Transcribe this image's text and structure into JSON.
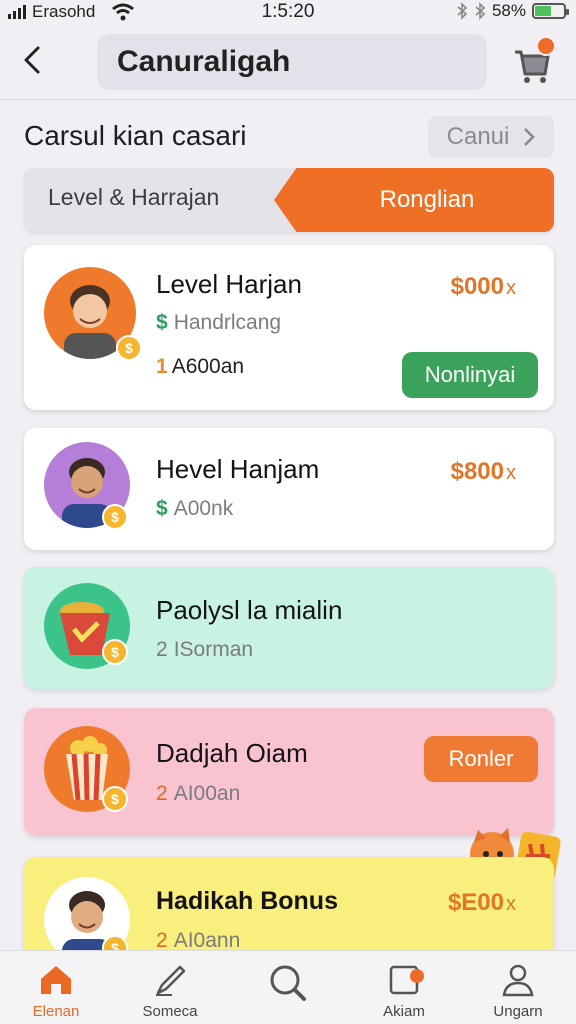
{
  "status": {
    "carrier": "Erasohd",
    "time": "1:5:20",
    "battery": "58%",
    "battery_level": 0.58
  },
  "header": {
    "title": "Canuraligah"
  },
  "section": {
    "title": "Carsul kian casari",
    "see_all": "Canui"
  },
  "tabs": {
    "left": "Level & Harrajan",
    "right": "Ronglian"
  },
  "cards": [
    {
      "title": "Level Harjan",
      "subtitle": "Handrlcang",
      "meta_num": "1",
      "meta_text": "A600an",
      "price": "$000",
      "price_suffix": "x",
      "button": "Nonlinyai",
      "bg": "#ffffff",
      "avatar_bg": "#f07a2c"
    },
    {
      "title": "Hevel Hanjam",
      "subtitle": "A00nk",
      "price": "$800",
      "price_suffix": "x",
      "bg": "#ffffff",
      "avatar_bg": "#b57ed9"
    },
    {
      "title": "Paolysl la mialin",
      "sub_num": "2",
      "subtitle": "ISorman",
      "bg": "#c8f3e2",
      "avatar_bg": "#3cc38a"
    },
    {
      "title": "Dadjah Oiam",
      "sub_num": "2",
      "subtitle": "AI00an",
      "button": "Ronler",
      "bg": "#f9c4cf",
      "avatar_bg": "#f07a2c"
    },
    {
      "title": "Hadikah Bonus",
      "sub_num": "2",
      "subtitle": "AI0ann",
      "price": "$E00",
      "price_suffix": "x",
      "bg": "#f8ef7d",
      "avatar_bg": "#ffffff"
    }
  ],
  "nav": [
    {
      "label": "Elenan",
      "icon": "home-icon",
      "active": true
    },
    {
      "label": "Someca",
      "icon": "pencil-icon"
    },
    {
      "label": "",
      "icon": "search-icon"
    },
    {
      "label": "Akiam",
      "icon": "inbox-icon"
    },
    {
      "label": "Ungarn",
      "icon": "profile-icon"
    }
  ],
  "colors": {
    "accent": "#ef6f24",
    "green": "#3ba25b",
    "bg": "#f1eff4"
  }
}
